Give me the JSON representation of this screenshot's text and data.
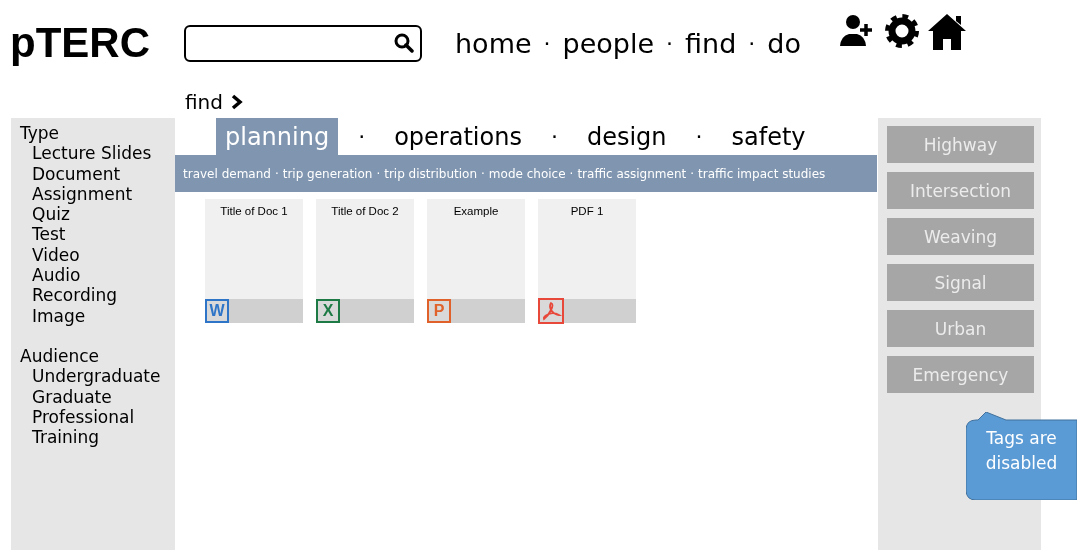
{
  "logo": "pTERC",
  "nav": [
    {
      "label": "home"
    },
    {
      "separator": "·",
      "label": "people"
    },
    {
      "separator": "·",
      "label": "find"
    },
    {
      "separator": "·",
      "label": "do"
    }
  ],
  "breadcrumb": {
    "label": "find"
  },
  "sidebar": {
    "groups": [
      {
        "title": "Type",
        "items": [
          "Lecture Slides",
          "Document",
          "Assignment",
          "Quiz",
          "Test",
          "Video",
          "Audio",
          "Recording",
          "Image"
        ]
      },
      {
        "title": "Audience",
        "items": [
          "Undergraduate",
          "Graduate",
          "Professional",
          "Training"
        ]
      }
    ]
  },
  "tabs": [
    {
      "label": "planning",
      "selected": true
    },
    {
      "separator": "·",
      "label": "operations",
      "selected": false
    },
    {
      "separator": "·",
      "label": "design",
      "selected": false
    },
    {
      "separator": "·",
      "label": "safety",
      "selected": false
    }
  ],
  "subtopics": [
    {
      "label": "travel demand"
    },
    {
      "separator": "·",
      "label": "trip generation"
    },
    {
      "separator": "·",
      "label": "trip distribution"
    },
    {
      "separator": "·",
      "label": "mode choice"
    },
    {
      "separator": "·",
      "label": "traffic assignment"
    },
    {
      "separator": "·",
      "label": "traffic impact studies"
    }
  ],
  "documents": [
    {
      "title": "Title of Doc 1",
      "kind": "word",
      "badge": "W"
    },
    {
      "title": "Title of Doc 2",
      "kind": "excel",
      "badge": "X"
    },
    {
      "title": "Example",
      "kind": "powerpoint",
      "badge": "P"
    },
    {
      "title": "PDF 1",
      "kind": "pdf"
    }
  ],
  "tags": [
    {
      "label": "Highway",
      "disabled": true
    },
    {
      "label": "Intersection",
      "disabled": true
    },
    {
      "label": "Weaving",
      "disabled": true
    },
    {
      "label": "Signal",
      "disabled": true
    },
    {
      "label": "Urban",
      "disabled": true
    },
    {
      "label": "Emergency",
      "disabled": true
    }
  ],
  "callout": {
    "text": "Tags are disabled"
  }
}
